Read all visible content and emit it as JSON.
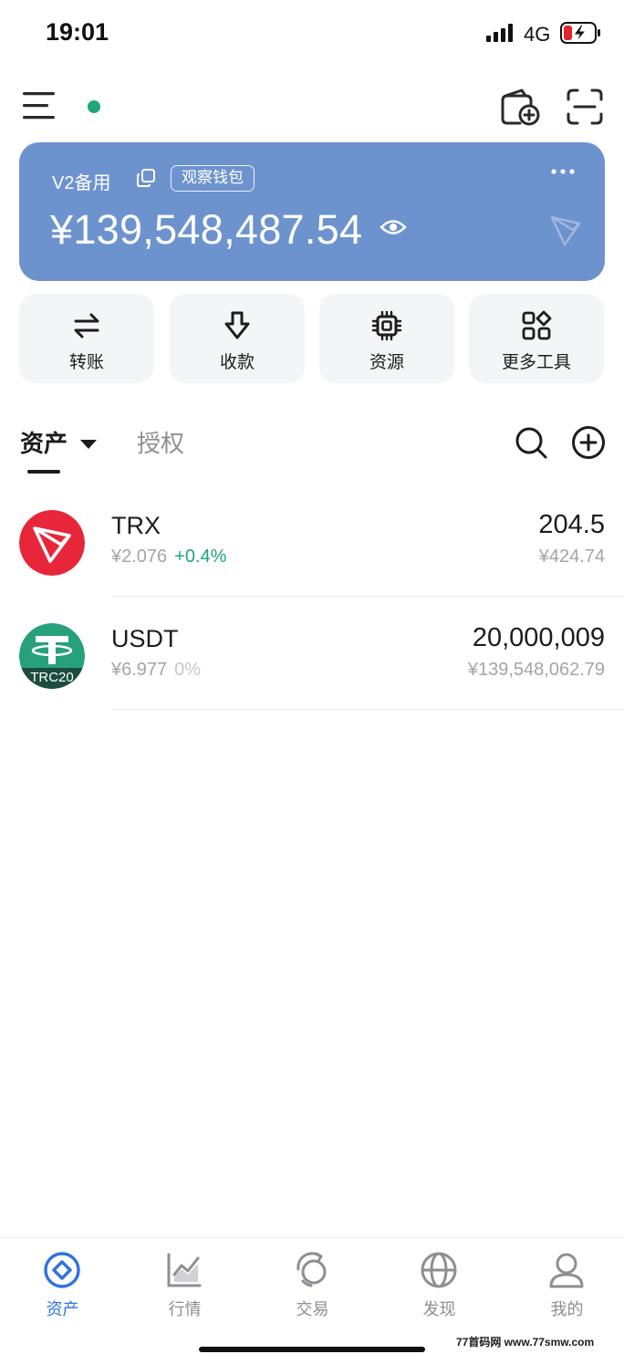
{
  "status_bar": {
    "time": "19:01",
    "network": "4G",
    "icons": [
      "signal-icon",
      "battery-charging-icon"
    ]
  },
  "header": {
    "icons": [
      "menu-icon",
      "add-wallet-icon",
      "scan-icon"
    ],
    "online_color": "#1fa774"
  },
  "wallet_card": {
    "name": "V2备用",
    "badge": "观察钱包",
    "balance": "¥139,548,487.54",
    "color": "#6d93cf",
    "icons": [
      "copy-icon",
      "more-icon",
      "eye-icon",
      "tron-watermark-icon"
    ]
  },
  "actions": [
    {
      "label": "转账",
      "icon": "transfer-icon"
    },
    {
      "label": "收款",
      "icon": "receive-icon"
    },
    {
      "label": "资源",
      "icon": "chip-icon"
    },
    {
      "label": "更多工具",
      "icon": "apps-icon"
    }
  ],
  "tabs": {
    "assets": "资产",
    "authorization": "授权",
    "icons": [
      "search-icon",
      "add-circle-icon"
    ]
  },
  "tokens": [
    {
      "symbol": "TRX",
      "price": "¥2.076",
      "change": "+0.4%",
      "change_color": "#1fa774",
      "amount": "204.5",
      "value": "¥424.74",
      "logo": "tron-logo"
    },
    {
      "symbol": "USDT",
      "price": "¥6.977",
      "change": "0%",
      "change_color": "#c7c7cc",
      "amount": "20,000,009",
      "value": "¥139,548,062.79",
      "logo": "tether-trc20-logo",
      "logo_label": "TRC20"
    }
  ],
  "bottom_nav": [
    {
      "label": "资产",
      "icon": "assets-icon",
      "active": true
    },
    {
      "label": "行情",
      "icon": "market-chart-icon",
      "active": false
    },
    {
      "label": "交易",
      "icon": "swap-icon",
      "active": false
    },
    {
      "label": "发现",
      "icon": "globe-icon",
      "active": false
    },
    {
      "label": "我的",
      "icon": "profile-icon",
      "active": false
    }
  ],
  "accent_color": "#2f72e0",
  "footer_watermark": "77首码网 www.77smw.com"
}
